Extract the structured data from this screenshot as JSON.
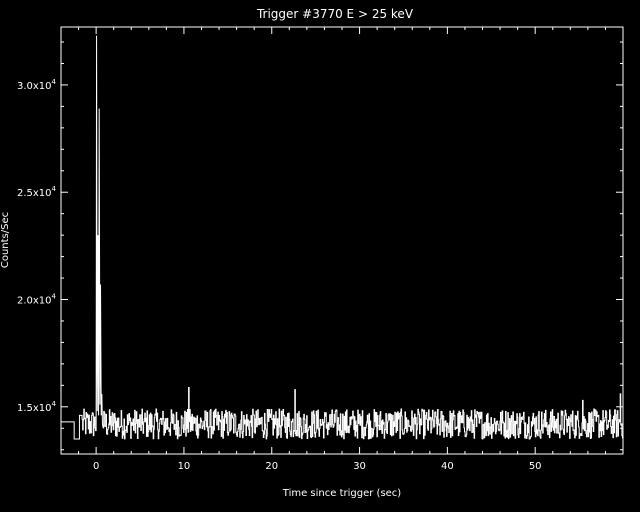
{
  "chart_data": {
    "type": "line",
    "title": "Trigger #3770  E > 25 keV",
    "xlabel": "Time since trigger (sec)",
    "ylabel": "Counts/Sec",
    "xlim": [
      -4,
      60
    ],
    "ylim": [
      12800,
      32700
    ],
    "x_ticks": [
      0,
      10,
      20,
      30,
      40,
      50
    ],
    "y_ticks": [
      {
        "value": 15000,
        "mantissa": "1.5x10",
        "exp": "4"
      },
      {
        "value": 20000,
        "mantissa": "2.0x10",
        "exp": "4"
      },
      {
        "value": 25000,
        "mantissa": "2.5x10",
        "exp": "4"
      },
      {
        "value": 30000,
        "mantissa": "3.0x10",
        "exp": "4"
      }
    ],
    "background": "#000000",
    "foreground": "#ffffff",
    "grid": false,
    "legend": "none",
    "series": [
      {
        "baseline": 14200,
        "noise_amplitude": 700,
        "pre_trigger_steps": [
          {
            "x0": -4.0,
            "x1": -2.5,
            "y": 14300
          },
          {
            "x0": -2.5,
            "x1": -1.9,
            "y": 13500
          },
          {
            "x0": -1.9,
            "x1": -1.6,
            "y": 14600
          }
        ],
        "spike_points": [
          {
            "x": 0.0,
            "y": 14100
          },
          {
            "x": 0.05,
            "y": 32300
          },
          {
            "x": 0.13,
            "y": 14800
          },
          {
            "x": 0.2,
            "y": 23000
          },
          {
            "x": 0.28,
            "y": 14600
          },
          {
            "x": 0.35,
            "y": 28900
          },
          {
            "x": 0.43,
            "y": 15100
          },
          {
            "x": 0.5,
            "y": 20700
          },
          {
            "x": 0.58,
            "y": 14600
          },
          {
            "x": 0.65,
            "y": 15600
          },
          {
            "x": 0.72,
            "y": 14200
          }
        ],
        "notable_peaks": [
          {
            "x": 10.5,
            "y": 15900
          },
          {
            "x": 22.6,
            "y": 15800
          },
          {
            "x": 55.4,
            "y": 15300
          },
          {
            "x": 59.7,
            "y": 15600
          }
        ]
      }
    ]
  }
}
